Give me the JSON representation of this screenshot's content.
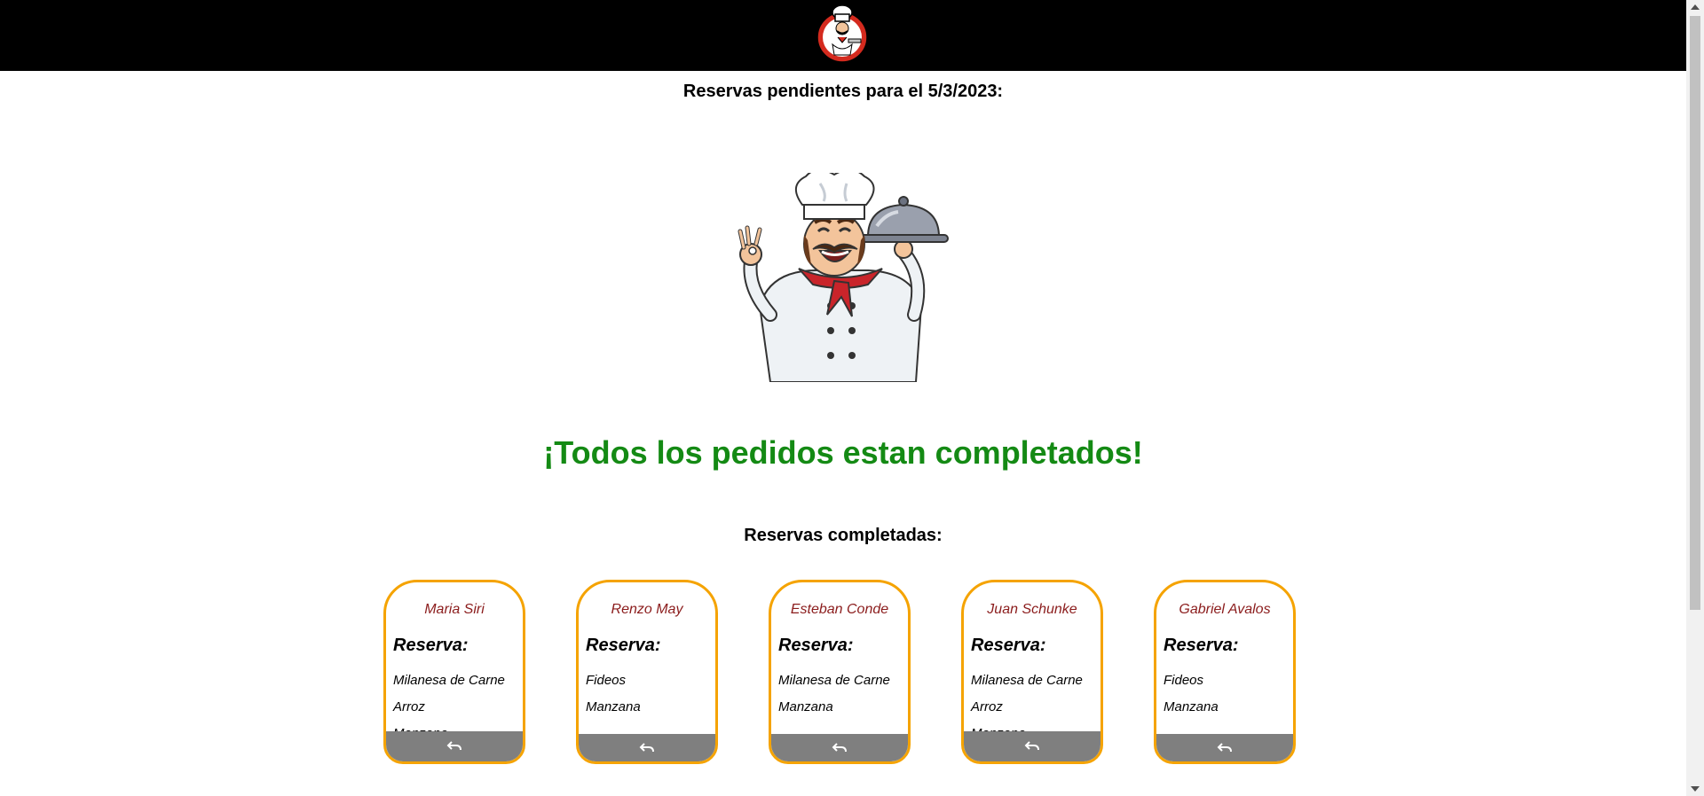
{
  "header": {
    "logo_icon": "chef-logo-icon",
    "background": "#000000"
  },
  "pending": {
    "title": "Reservas pendientes para el 5/3/2023:",
    "illustration": "chef-with-cloche-illustration",
    "empty_message": "¡Todos los pedidos estan completados!",
    "message_color": "#148a14"
  },
  "completed": {
    "title": "Reservas completadas:",
    "card_label": "Reserva:",
    "undo_icon": "undo-icon",
    "border_color": "#f5a300",
    "cards": [
      {
        "name": "Maria Siri",
        "items": [
          "Milanesa de Carne",
          "Arroz",
          "Manzana"
        ]
      },
      {
        "name": "Renzo May",
        "items": [
          "Fideos",
          "Manzana"
        ]
      },
      {
        "name": "Esteban Conde",
        "items": [
          "Milanesa de Carne",
          "Manzana"
        ]
      },
      {
        "name": "Juan Schunke",
        "items": [
          "Milanesa de Carne",
          "Arroz",
          "Manzana"
        ]
      },
      {
        "name": "Gabriel Avalos",
        "items": [
          "Fideos",
          "Manzana"
        ]
      }
    ]
  }
}
